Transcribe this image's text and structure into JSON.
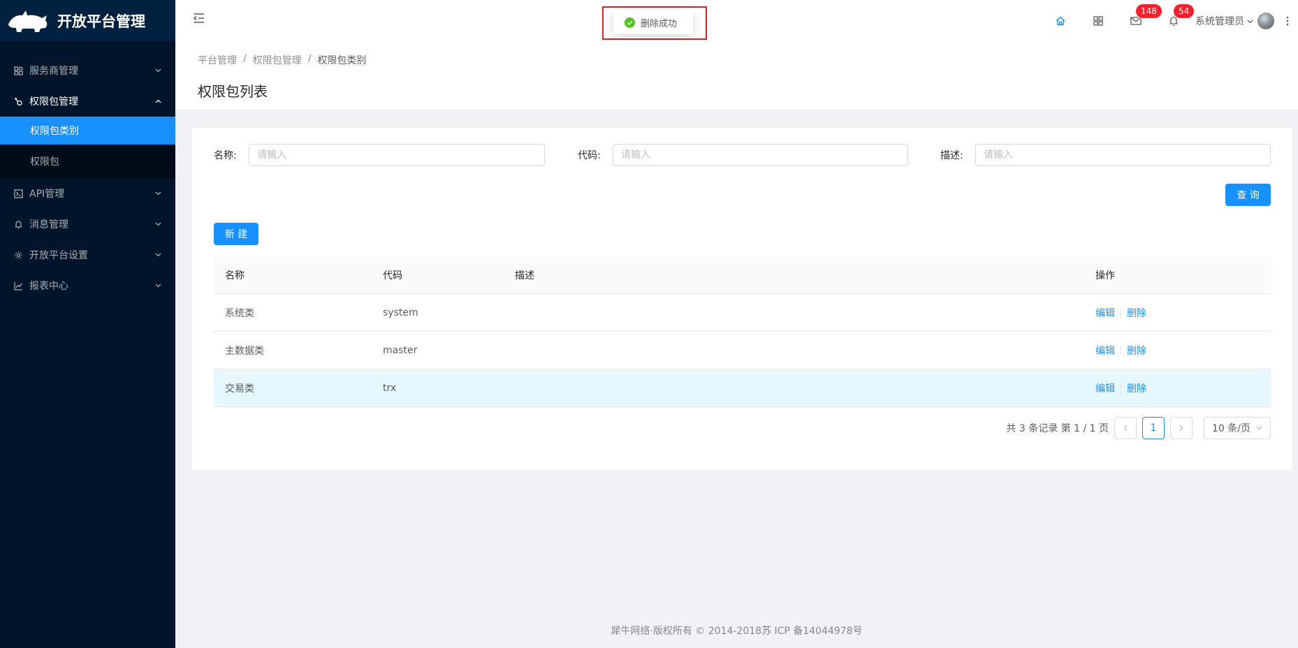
{
  "app": {
    "title": "开放平台管理"
  },
  "sidebar": {
    "items": [
      {
        "label": "服务商管理",
        "icon": "appstore-icon"
      },
      {
        "label": "权限包管理",
        "icon": "key-icon",
        "open": true,
        "children": [
          {
            "label": "权限包类别",
            "active": true
          },
          {
            "label": "权限包"
          }
        ]
      },
      {
        "label": "API管理",
        "icon": "api-icon"
      },
      {
        "label": "消息管理",
        "icon": "bell-icon"
      },
      {
        "label": "开放平台设置",
        "icon": "setting-icon"
      },
      {
        "label": "报表中心",
        "icon": "line-chart-icon"
      }
    ]
  },
  "header": {
    "mail_count": "148",
    "notice_count": "54",
    "user_name": "系统管理员"
  },
  "toast": {
    "message": "删除成功"
  },
  "breadcrumb": [
    "平台管理",
    "权限包管理",
    "权限包类别"
  ],
  "page_title": "权限包列表",
  "filters": [
    {
      "label": "名称:",
      "placeholder": "请输入",
      "value": ""
    },
    {
      "label": "代码:",
      "placeholder": "请输入",
      "value": ""
    },
    {
      "label": "描述:",
      "placeholder": "请输入",
      "value": ""
    }
  ],
  "buttons": {
    "query": "查 询",
    "new": "新 建"
  },
  "table": {
    "headers": [
      "名称",
      "代码",
      "描述",
      "操作"
    ],
    "rows": [
      {
        "name": "系统类",
        "code": "system",
        "desc": ""
      },
      {
        "name": "主数据类",
        "code": "master",
        "desc": ""
      },
      {
        "name": "交易类",
        "code": "trx",
        "desc": ""
      }
    ],
    "actions": {
      "edit": "编辑",
      "delete": "删除"
    }
  },
  "pagination": {
    "total_text": "共 3 条记录 第 1 / 1 页",
    "current": "1",
    "page_size": "10 条/页"
  },
  "footer": "犀牛网络·版权所有 © 2014-2018苏 ICP 备14044978号",
  "colors": {
    "primary": "#1890ff",
    "sidebar": "#001529",
    "danger": "#f5222d"
  }
}
